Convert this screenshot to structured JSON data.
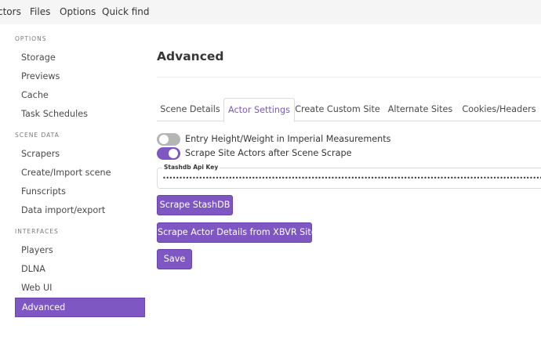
{
  "topnav": {
    "items": [
      "ctors",
      "Files",
      "Options",
      "Quick find"
    ]
  },
  "sidebar": {
    "sections": [
      {
        "label": "OPTIONS",
        "items": [
          "Storage",
          "Previews",
          "Cache",
          "Task Schedules"
        ]
      },
      {
        "label": "SCENE DATA",
        "items": [
          "Scrapers",
          "Create/Import scene",
          "Funscripts",
          "Data import/export"
        ]
      },
      {
        "label": "INTERFACES",
        "items": [
          "Players",
          "DLNA",
          "Web UI",
          "Advanced"
        ]
      }
    ],
    "active_item": "Advanced"
  },
  "main": {
    "title": "Advanced",
    "tabs": [
      "Scene Details",
      "Actor Settings",
      "Create Custom Site",
      "Alternate Sites",
      "Cookies/Headers"
    ],
    "active_tab": "Actor Settings",
    "toggles": [
      {
        "label": "Entry Height/Weight in Imperial Measurements",
        "on": false
      },
      {
        "label": "Scrape Site Actors after Scene Scrape",
        "on": true
      }
    ],
    "api_key_field": {
      "label": "Stashdb Api Key",
      "value": "••••••••••••••••••••••••••••••••••••••••••••••••••••••••••••••••••••••••••••••••••••••••••••••••••••••••••••••••••••••"
    },
    "buttons": {
      "scrape_stashdb": "Scrape StashDB",
      "scrape_actor_details": "Scrape Actor Details from XBVR Sites",
      "save": "Save"
    }
  },
  "colors": {
    "accent": "#7e57c2",
    "toggle_off": "#b5b5b5",
    "topbar_bg": "#f5f5f5"
  }
}
